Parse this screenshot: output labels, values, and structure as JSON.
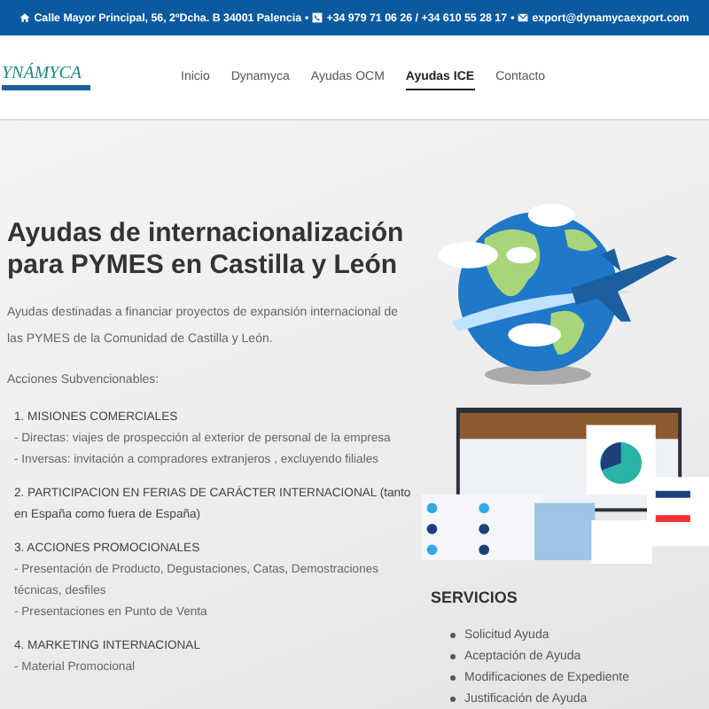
{
  "top_bar": {
    "address": "Calle Mayor Principal, 56, 2ºDcha. B 34001 Palencia",
    "separator_1": "•",
    "phones": "+34 979 71 06 26 / +34 610 55 28 17",
    "separator_2": "•",
    "email": "export@dynamycaexport.com"
  },
  "logo": {
    "text": "YNÁMYCA"
  },
  "nav": [
    {
      "label": "Inicio",
      "selected": false
    },
    {
      "label": "Dynamyca",
      "selected": false
    },
    {
      "label": "Ayudas OCM",
      "selected": false
    },
    {
      "label": "Ayudas ICE",
      "selected": true
    },
    {
      "label": "Contacto",
      "selected": false
    }
  ],
  "main": {
    "title": "Ayudas de internacionalización para PYMES en Castilla y León",
    "intro": "Ayudas destinadas a financiar proyectos de expansión internacional de las PYMES de la Comunidad de Castilla y León.",
    "subheading": "Acciones Subvencionables:",
    "sections": [
      {
        "heading": "1. MISIONES COMERCIALES",
        "lines": [
          "- Directas: viajes de prospección al exterior de personal de la empresa",
          "- Inversas: invitación a compradores extranjeros , excluyendo filiales"
        ]
      },
      {
        "heading": "2. PARTICIPACION EN FERIAS DE CARÁCTER INTERNACIONAL (tanto en España como fuera de España)"
      },
      {
        "heading": "3. ACCIONES PROMOCIONALES",
        "lines": [
          "- Presentación de Producto, Degustaciones, Catas, Demostraciones técnicas, desfiles",
          "- Presentaciones en Punto de Venta"
        ]
      },
      {
        "heading": "4. MARKETING INTERNACIONAL",
        "lines": [
          "- Material Promocional"
        ]
      }
    ]
  },
  "services": {
    "title": "SERVICIOS",
    "items": [
      "Solicitud Ayuda",
      "Aceptación de Ayuda",
      "Modificaciones de Expediente",
      "Justificación de Ayuda"
    ]
  }
}
